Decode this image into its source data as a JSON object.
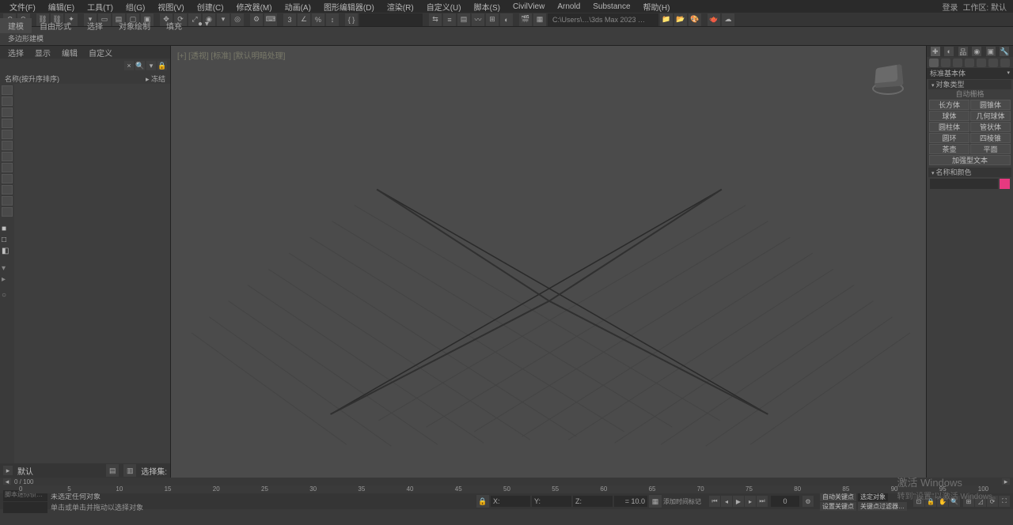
{
  "menu": {
    "items": [
      "文件(F)",
      "编辑(E)",
      "工具(T)",
      "组(G)",
      "视图(V)",
      "创建(C)",
      "修改器(M)",
      "动画(A)",
      "图形编辑器(D)",
      "渲染(R)",
      "自定义(U)",
      "脚本(S)",
      "CivilView",
      "Arnold",
      "Substance",
      "帮助(H)"
    ],
    "right": {
      "login": "登录",
      "workspace": "工作区: 默认"
    }
  },
  "toolbar": {
    "path": "C:\\Users\\…\\3ds Max 2023 …"
  },
  "ribbon": {
    "tabs": [
      "建模",
      "自由形式",
      "选择",
      "对象绘制",
      "填充"
    ],
    "subtitle": "多边形建模"
  },
  "leftpanel": {
    "tabs": [
      "选择",
      "显示",
      "编辑",
      "自定义"
    ],
    "sort_label": "名称(按升序排序)",
    "freeze_label": "▸ 冻结",
    "bottom_status": "默认",
    "bottom_sel": "选择集:"
  },
  "viewport": {
    "label_full": "[+] [透视] [标准] [默认明暗处理]"
  },
  "rightpanel": {
    "category": "标准基本体",
    "rollout_type": "▾ 对象类型",
    "autogrid": "自动栅格",
    "buttons": [
      "长方体",
      "圆锥体",
      "球体",
      "几何球体",
      "圆柱体",
      "管状体",
      "圆环",
      "四棱锥",
      "茶壶",
      "平面",
      "加强型文本"
    ],
    "rollout_name": "▾ 名称和颜色"
  },
  "timeline": {
    "range": "0 / 100",
    "ticks": [
      0,
      5,
      10,
      15,
      20,
      25,
      30,
      35,
      40,
      45,
      50,
      55,
      60,
      65,
      70,
      75,
      80,
      85,
      90,
      95,
      100
    ]
  },
  "status": {
    "selection": "未选定任何对象",
    "hint": "单击或单击并拖动以选择对象",
    "x": "X:",
    "y": "Y:",
    "z": "Z:",
    "grid": "= 10.0",
    "frame": "0",
    "autokey": "自动关键点",
    "selset": "选定对象",
    "setkey": "设置关键点",
    "keyfilter": "关键点过滤器…",
    "addtime": "添加时间标记"
  },
  "watermark": {
    "line1": "激活 Windows",
    "line2": "转到\"设置\"以激活 Windows。"
  }
}
